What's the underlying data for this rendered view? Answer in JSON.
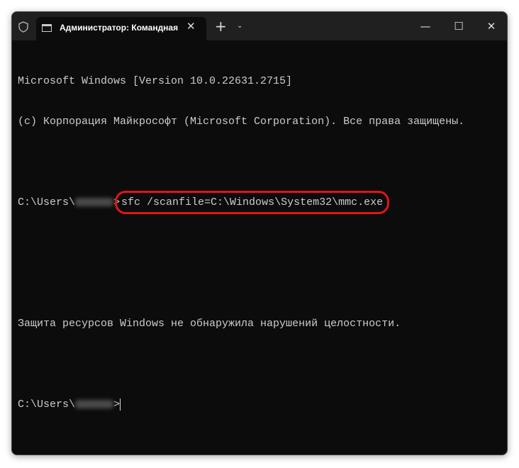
{
  "window": {
    "tab_title": "Администратор: Командная",
    "icons": [
      "shield-icon",
      "cmd-icon",
      "close-icon",
      "plus-icon",
      "chevron-down-icon",
      "minimize-icon",
      "maximize-icon",
      "close-icon"
    ]
  },
  "terminal": {
    "line1": "Microsoft Windows [Version 10.0.22631.2715]",
    "line2": "(c) Корпорация Майкрософт (Microsoft Corporation). Все права защищены.",
    "prompt_prefix": "C:\\Users\\",
    "prompt_suffix": ">",
    "command": "sfc /scanfile=C:\\Windows\\System32\\mmc.exe",
    "result": "Защита ресурсов Windows не обнаружила нарушений целостности.",
    "highlight_color": "#e1141c"
  }
}
